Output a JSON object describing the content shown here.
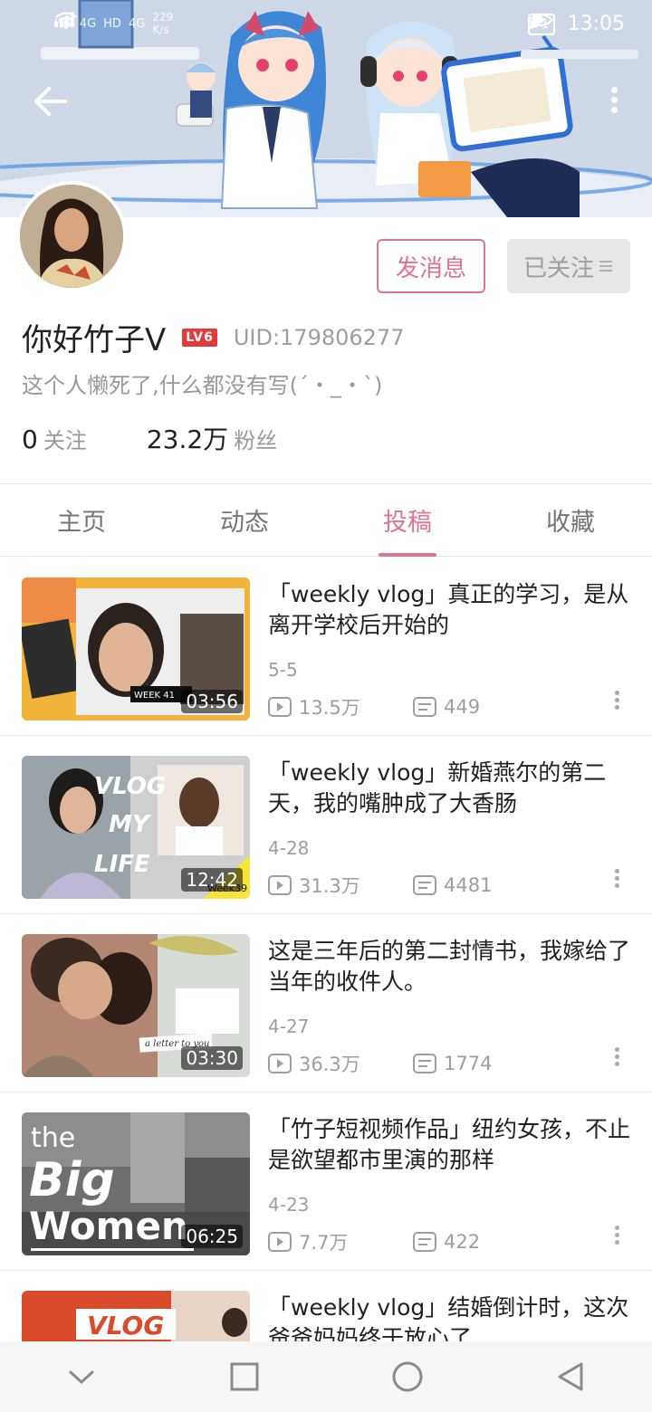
{
  "status_bar": {
    "network_labels": [
      "HD",
      "4G",
      "HD",
      "4G"
    ],
    "speed": "229",
    "speed_unit": "K/s",
    "battery": "71",
    "time": "13:05"
  },
  "header": {
    "back_icon": "arrow-left-icon",
    "more_icon": "more-vertical-icon"
  },
  "profile": {
    "username": "你好竹子V",
    "level": "LV6",
    "uid": "UID:179806277",
    "bio": "这个人懒死了,什么都没有写(´・_・`)",
    "following_count": "0",
    "following_label": "关注",
    "followers_count": "23.2万",
    "followers_label": "粉丝",
    "message_button": "发消息",
    "follow_button": "已关注",
    "accent": "#e0738f"
  },
  "tabs": [
    {
      "label": "主页",
      "active": false
    },
    {
      "label": "动态",
      "active": false
    },
    {
      "label": "投稿",
      "active": true
    },
    {
      "label": "收藏",
      "active": false
    }
  ],
  "videos": [
    {
      "title": "「weekly vlog」真正的学习，是从离开学校后开始的",
      "date": "5-5",
      "views": "13.5万",
      "comments": "449",
      "duration": "03:56"
    },
    {
      "title": "「weekly vlog」新婚燕尔的第二天，我的嘴肿成了大香肠",
      "date": "4-28",
      "views": "31.3万",
      "comments": "4481",
      "duration": "12:42"
    },
    {
      "title": "这是三年后的第二封情书，我嫁给了当年的收件人。",
      "date": "4-27",
      "views": "36.3万",
      "comments": "1774",
      "duration": "03:30"
    },
    {
      "title": "「竹子短视频作品」纽约女孩，不止是欲望都市里演的那样",
      "date": "4-23",
      "views": "7.7万",
      "comments": "422",
      "duration": "06:25"
    },
    {
      "title": "「weekly vlog」结婚倒计时，这次爸爸妈妈终于放心了",
      "date": "",
      "views": "",
      "comments": "",
      "duration": ""
    }
  ],
  "thumb_text": {
    "t1": "WEEK 41",
    "t2a": "VLOG",
    "t2b": "MY",
    "t2c": "LIFE",
    "t2d": "Week39",
    "t3": "a letter to you",
    "t4a": "the",
    "t4b": "Big",
    "t4c": "Women",
    "t5": "VLOG"
  },
  "navbar": {
    "icons": [
      "chevron-down-icon",
      "square-icon",
      "circle-icon",
      "triangle-back-icon"
    ]
  }
}
